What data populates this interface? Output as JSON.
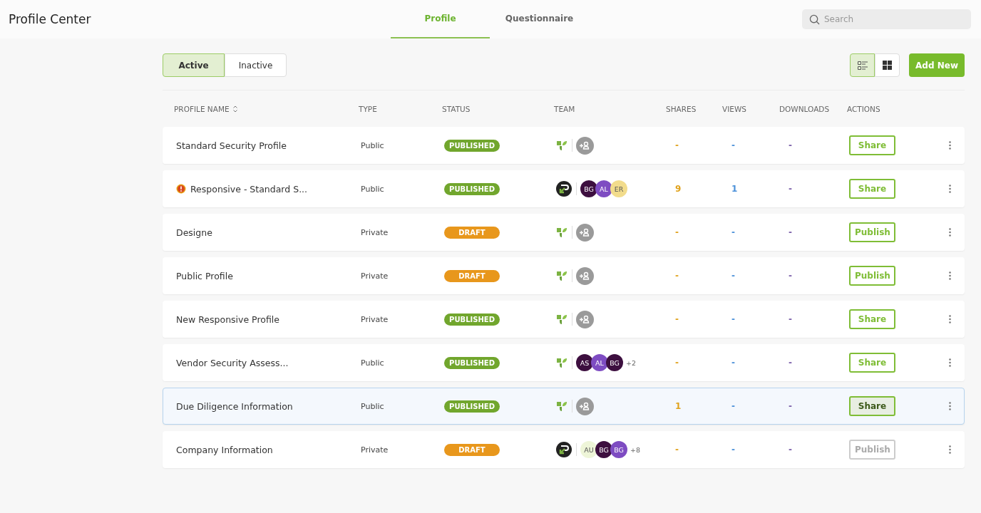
{
  "app": {
    "title": "Profile Center"
  },
  "nav_tabs": [
    {
      "label": "Profile",
      "selected": true
    },
    {
      "label": "Questionnaire",
      "selected": false
    }
  ],
  "search": {
    "placeholder": "Search"
  },
  "filter_tabs": [
    {
      "label": "Active",
      "selected": true
    },
    {
      "label": "Inactive",
      "selected": false
    }
  ],
  "view_toggles": [
    {
      "kind": "list",
      "selected": true
    },
    {
      "kind": "grid",
      "selected": false
    }
  ],
  "add_button": "Add New",
  "columns": [
    "PROFILE NAME",
    "TYPE",
    "STATUS",
    "TEAM",
    "SHARES",
    "VIEWS",
    "DOWNLOADS",
    "ACTIONS"
  ],
  "rows": [
    {
      "name": "Standard Security Profile",
      "warning": false,
      "type": "Public",
      "status": {
        "label": "PUBLISHED",
        "kind": "published"
      },
      "team_logo": {
        "kind": "leaf"
      },
      "invite": true,
      "members": [],
      "shares": "-",
      "views": "-",
      "downloads": "-",
      "action": {
        "label": "Share",
        "disabled": false
      },
      "selected": false
    },
    {
      "name": "Responsive - Standard S...",
      "warning": true,
      "type": "Public",
      "status": {
        "label": "PUBLISHED",
        "kind": "published"
      },
      "team_logo": {
        "kind": "badge"
      },
      "invite": false,
      "members": [
        {
          "initials": "BG",
          "color": "#3d0f3f"
        },
        {
          "initials": "AL",
          "color": "#7e4cc2"
        },
        {
          "initials": "ER",
          "color": "#f2dc8c"
        }
      ],
      "shares": "9",
      "views": "1",
      "downloads": "-",
      "action": {
        "label": "Share",
        "disabled": false
      },
      "selected": false
    },
    {
      "name": "Designe",
      "warning": false,
      "type": "Private",
      "status": {
        "label": "DRAFT",
        "kind": "draft"
      },
      "team_logo": {
        "kind": "leaf"
      },
      "invite": true,
      "members": [],
      "shares": "-",
      "views": "-",
      "downloads": "-",
      "action": {
        "label": "Publish",
        "disabled": false
      },
      "selected": false
    },
    {
      "name": "Public Profile",
      "warning": false,
      "type": "Private",
      "status": {
        "label": "DRAFT",
        "kind": "draft"
      },
      "team_logo": {
        "kind": "leaf"
      },
      "invite": true,
      "members": [],
      "shares": "-",
      "views": "-",
      "downloads": "-",
      "action": {
        "label": "Publish",
        "disabled": false
      },
      "selected": false
    },
    {
      "name": "New Responsive Profile",
      "warning": false,
      "type": "Private",
      "status": {
        "label": "PUBLISHED",
        "kind": "published"
      },
      "team_logo": {
        "kind": "leaf"
      },
      "invite": true,
      "members": [],
      "shares": "-",
      "views": "-",
      "downloads": "-",
      "action": {
        "label": "Share",
        "disabled": false
      },
      "selected": false
    },
    {
      "name": "Vendor Security Assess...",
      "warning": false,
      "type": "Public",
      "status": {
        "label": "PUBLISHED",
        "kind": "published"
      },
      "team_logo": {
        "kind": "leaf"
      },
      "invite": false,
      "members": [
        {
          "initials": "AS",
          "color": "#3d0f3f"
        },
        {
          "initials": "AL",
          "color": "#7e4cc2"
        },
        {
          "initials": "BG",
          "color": "#3d0f3f"
        }
      ],
      "more": "+2",
      "shares": "-",
      "views": "-",
      "downloads": "-",
      "action": {
        "label": "Share",
        "disabled": false
      },
      "selected": false
    },
    {
      "name": "Due Diligence Information",
      "warning": false,
      "type": "Public",
      "status": {
        "label": "PUBLISHED",
        "kind": "published"
      },
      "team_logo": {
        "kind": "leaf"
      },
      "invite": true,
      "members": [],
      "shares": "1",
      "views": "-",
      "downloads": "-",
      "action": {
        "label": "Share",
        "disabled": false
      },
      "selected": true
    },
    {
      "name": "Company Information",
      "warning": false,
      "type": "Private",
      "status": {
        "label": "DRAFT",
        "kind": "draft"
      },
      "team_logo": {
        "kind": "badge"
      },
      "invite": false,
      "members": [
        {
          "initials": "AU",
          "color": "#eef5d8"
        },
        {
          "initials": "BG",
          "color": "#3d0f3f"
        },
        {
          "initials": "BG",
          "color": "#7e4cc2"
        }
      ],
      "more": "+8",
      "shares": "-",
      "views": "-",
      "downloads": "-",
      "action": {
        "label": "Publish",
        "disabled": true
      },
      "selected": false
    }
  ]
}
